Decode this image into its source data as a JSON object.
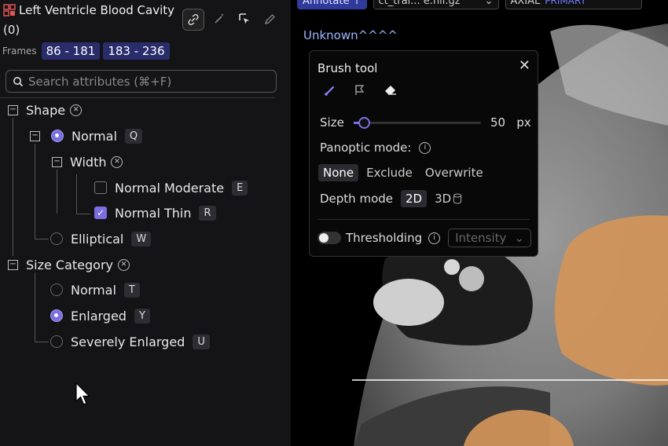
{
  "panel": {
    "title": "Left Ventricle Blood Cavity",
    "count": "(0)",
    "frames_label": "Frames",
    "frames": [
      "86 - 181",
      "183 - 236"
    ],
    "search_placeholder": "Search attributes (⌘+F)"
  },
  "tree": {
    "shape_label": "Shape",
    "normal_label": "Normal",
    "normal_key": "Q",
    "width_label": "Width",
    "normal_moderate_label": "Normal Moderate",
    "normal_moderate_key": "E",
    "normal_thin_label": "Normal Thin",
    "normal_thin_key": "R",
    "elliptical_label": "Elliptical",
    "elliptical_key": "W",
    "size_category_label": "Size Category",
    "size_normal_label": "Normal",
    "size_normal_key": "T",
    "enlarged_label": "Enlarged",
    "enlarged_key": "Y",
    "severely_enlarged_label": "Severely Enlarged",
    "severely_enlarged_key": "U"
  },
  "topbar": {
    "annotate_label": "Annotate ↑",
    "file_label": "ct_trai... e.nii.gz",
    "view_label": "AXIAL",
    "view_badge": "PRIMARY"
  },
  "viewer": {
    "label": "Unknown^^^^"
  },
  "brush": {
    "title": "Brush tool",
    "size_label": "Size",
    "size_value": "50",
    "size_unit": "px",
    "size_fraction": 0.08,
    "panoptic_label": "Panoptic mode:",
    "panoptic_options": [
      "None",
      "Exclude",
      "Overwrite"
    ],
    "depth_label": "Depth mode",
    "depth_2d": "2D",
    "depth_3d": "3D",
    "thresholding_label": "Thresholding",
    "intensity_label": "Intensity"
  },
  "colors": {
    "accent": "#7b6fe0",
    "chip": "#2a2d6b",
    "overlay": "#d4955a"
  }
}
